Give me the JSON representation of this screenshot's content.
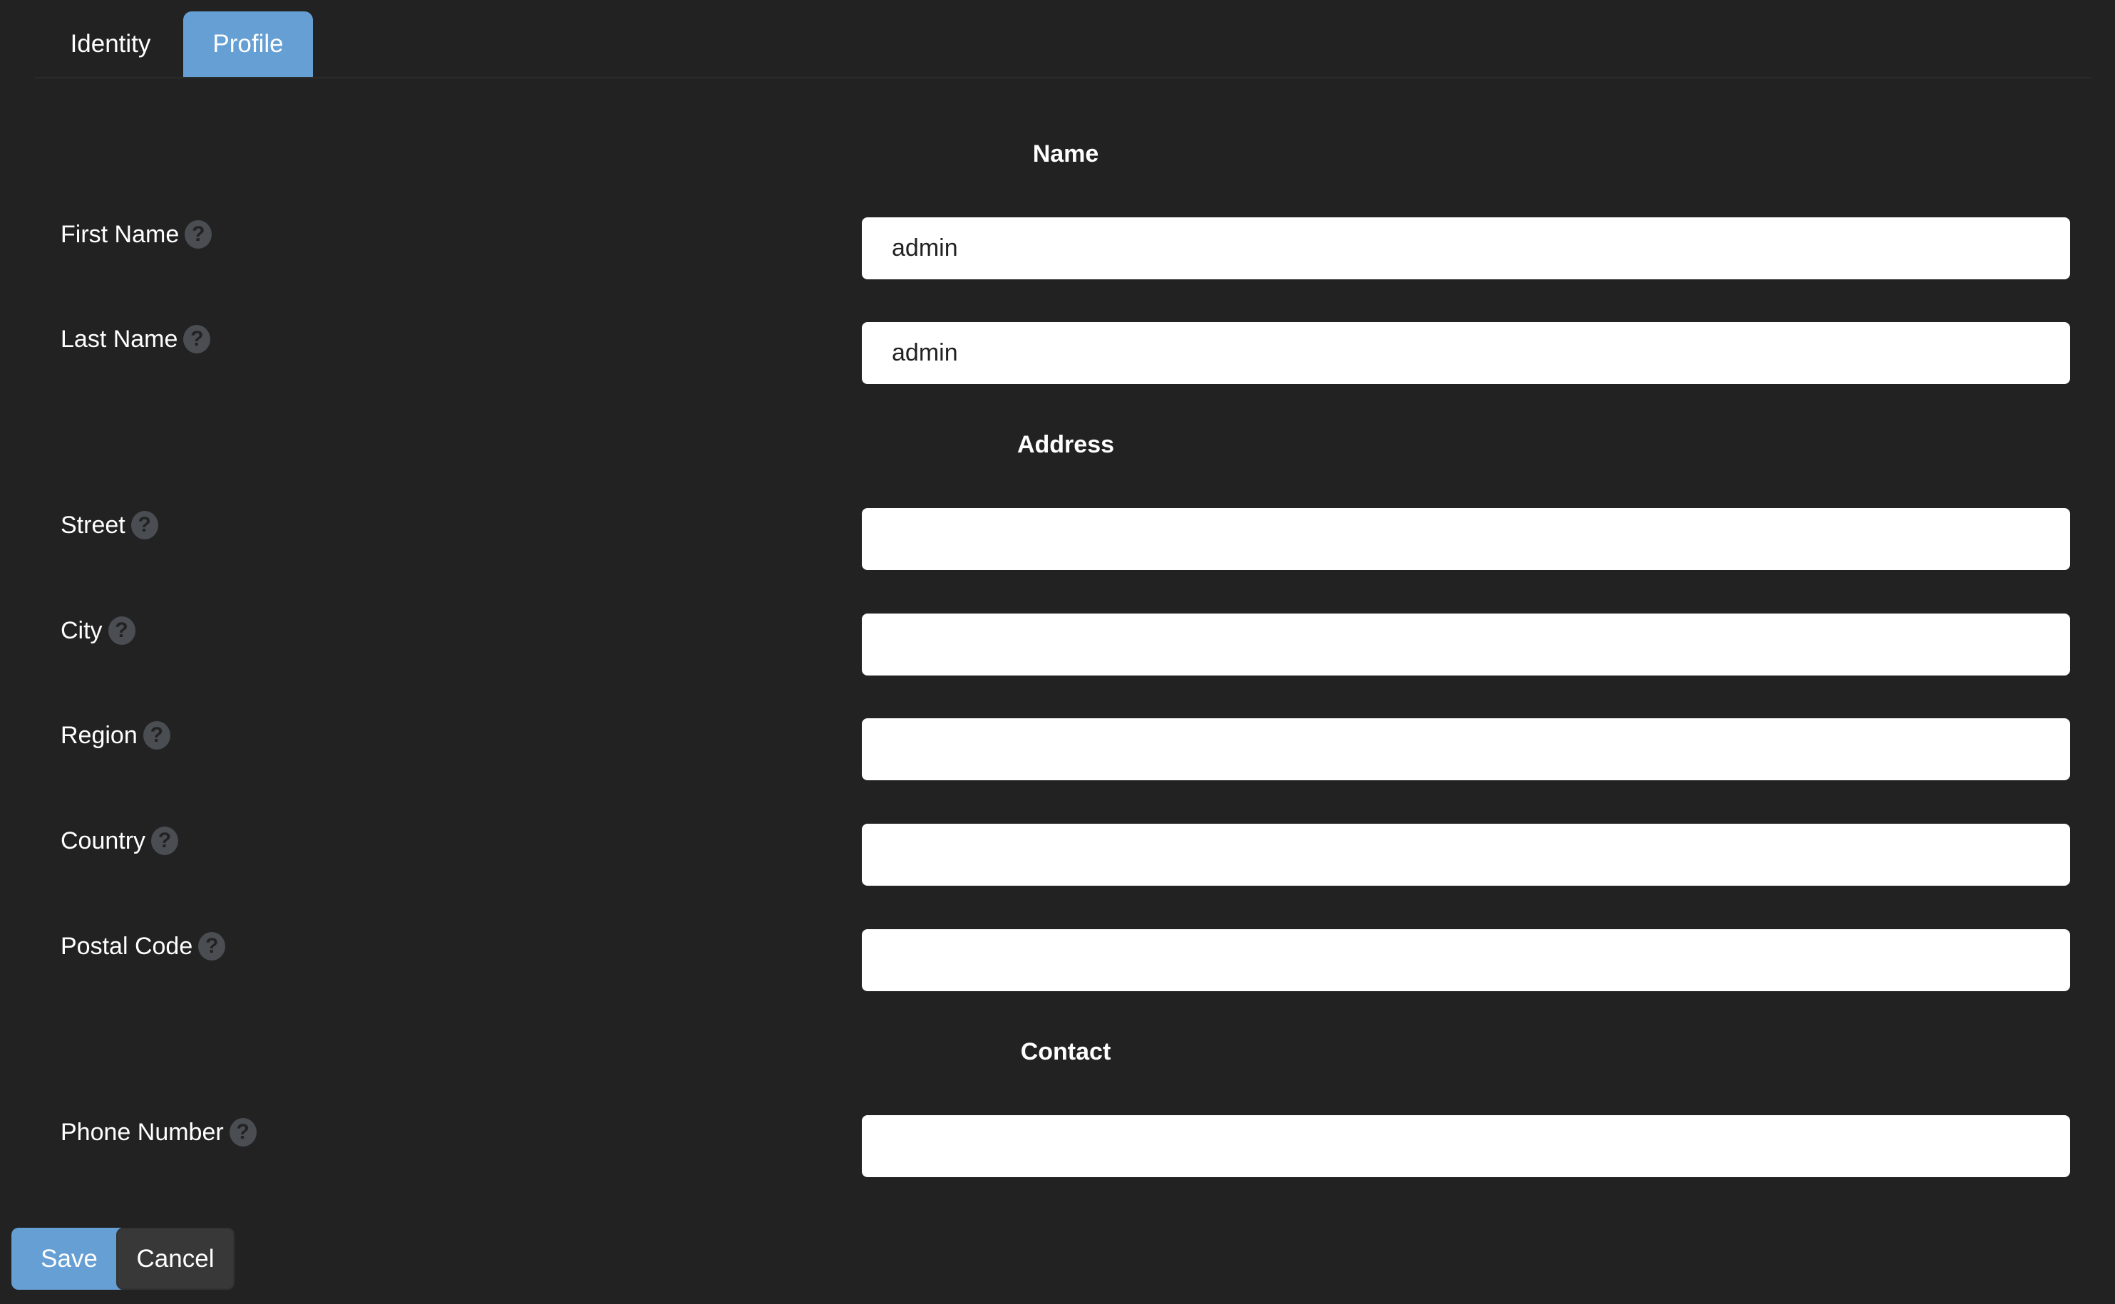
{
  "tabs": [
    {
      "label": "Identity",
      "active": false
    },
    {
      "label": "Profile",
      "active": true
    }
  ],
  "sections": {
    "name": "Name",
    "address": "Address",
    "contact": "Contact"
  },
  "fields": [
    {
      "label": "First Name",
      "value": "admin"
    },
    {
      "label": "Last Name",
      "value": "admin"
    },
    {
      "label": "Street",
      "value": ""
    },
    {
      "label": "City",
      "value": ""
    },
    {
      "label": "Region",
      "value": ""
    },
    {
      "label": "Country",
      "value": ""
    },
    {
      "label": "Postal Code",
      "value": ""
    },
    {
      "label": "Phone Number",
      "value": ""
    }
  ],
  "help_glyph": "?",
  "buttons": {
    "save": "Save",
    "cancel": "Cancel"
  },
  "colors": {
    "accent": "#659fd4",
    "background": "#222222"
  }
}
